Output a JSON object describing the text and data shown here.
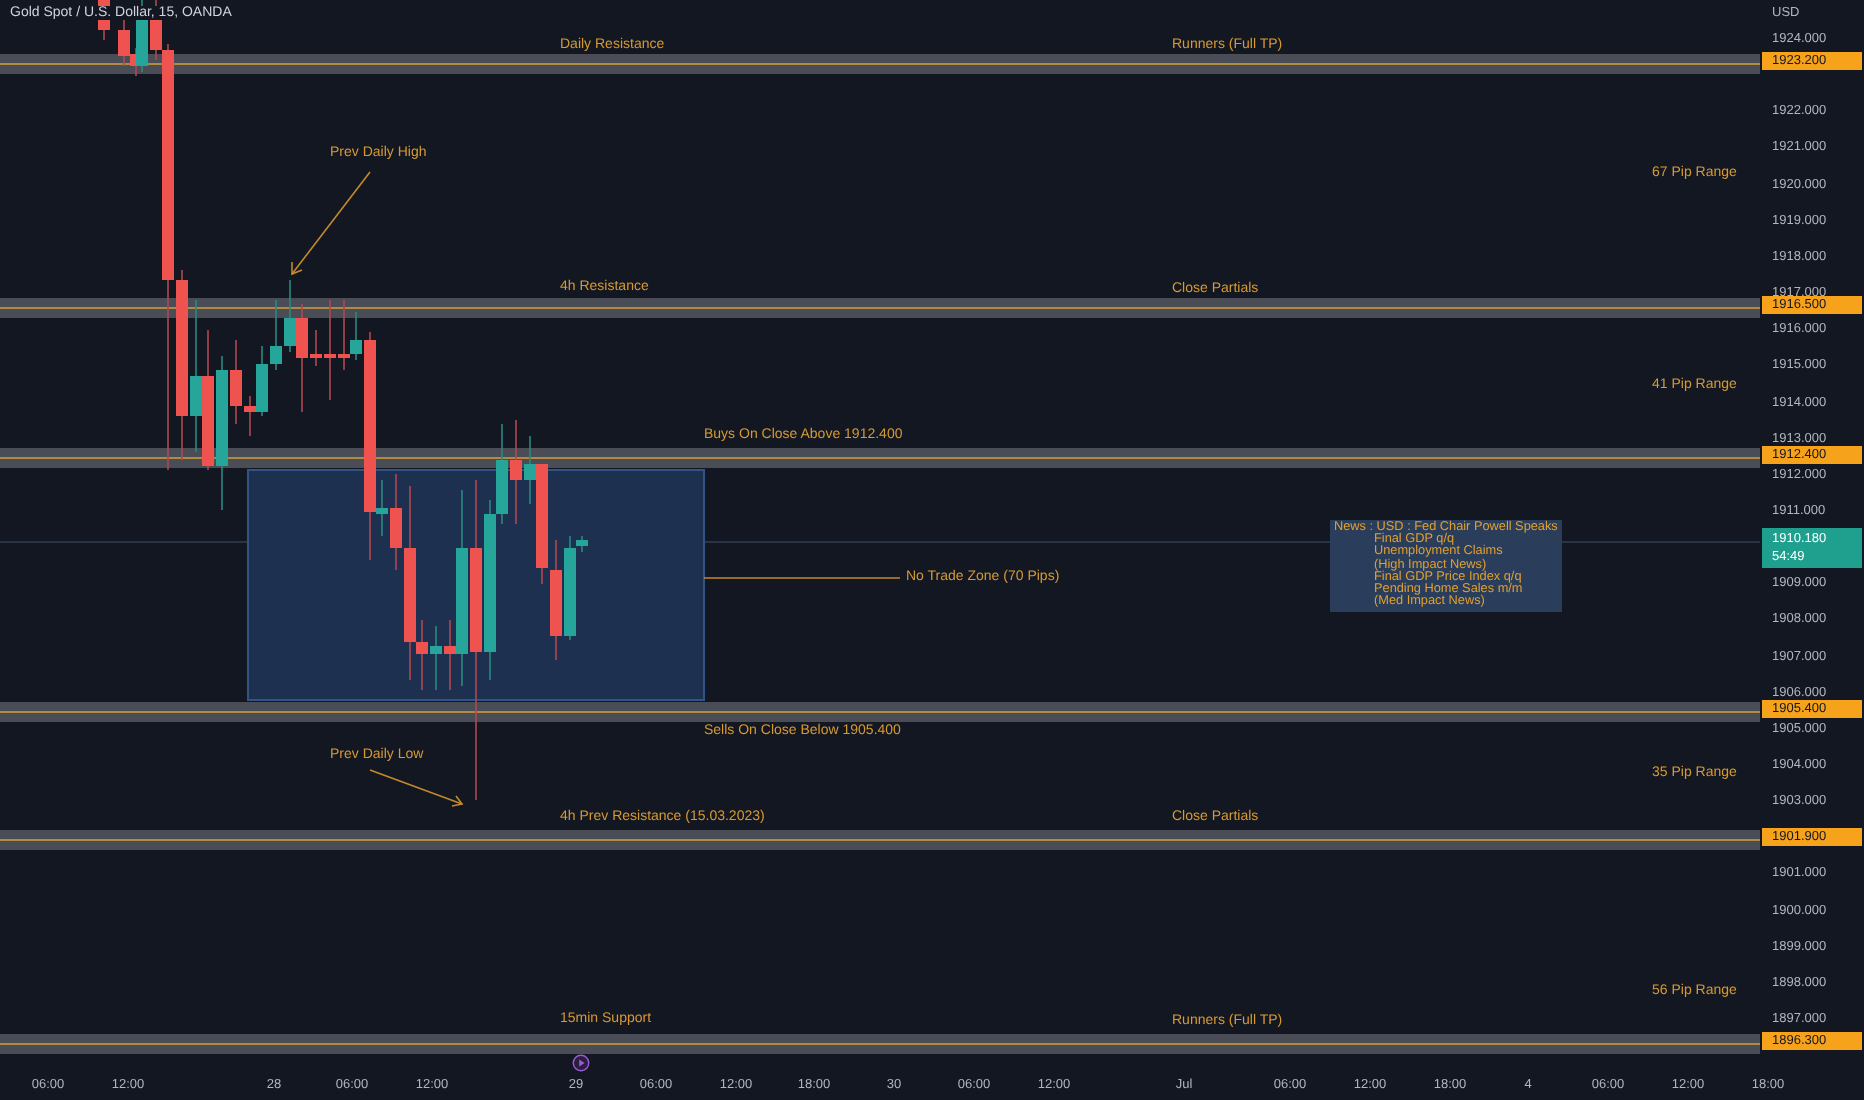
{
  "chart": {
    "title": "Gold Spot / U.S. Dollar, 15, OANDA",
    "annotations": [
      {
        "text": "Daily Resistance"
      },
      {
        "text": "Runners (Full TP)"
      },
      {
        "text": "Prev Daily High"
      },
      {
        "text": "67 Pip Range"
      },
      {
        "text": "4h Resistance"
      },
      {
        "text": "Close Partials"
      },
      {
        "text": "41 Pip Range"
      },
      {
        "text": "Buys On Close Above 1912.400"
      },
      {
        "text": "No Trade Zone (70 Pips)"
      },
      {
        "text": "Sells On Close Below 1905.400"
      },
      {
        "text": "Prev Daily Low"
      },
      {
        "text": "35 Pip Range"
      },
      {
        "text": "4h Prev Resistance (15.03.2023)"
      },
      {
        "text": "Close Partials"
      },
      {
        "text": "56 Pip Range"
      },
      {
        "text": "15min Support"
      },
      {
        "text": "Runners (Full TP)"
      }
    ],
    "news": {
      "lines": [
        "News : USD : Fed Chair Powell Speaks",
        "Final GDP q/q",
        "Unemployment Claims",
        "(High Impact News)",
        "Final GDP Price Index q/q",
        "Pending Home Sales m/m",
        "(Med Impact News)"
      ]
    }
  },
  "price_axis": {
    "unit": "USD",
    "ticks": [
      "1924.000",
      "1922.000",
      "1921.000",
      "1920.000",
      "1919.000",
      "1918.000",
      "1917.000",
      "1916.000",
      "1915.000",
      "1914.000",
      "1913.000",
      "1912.000",
      "1911.000",
      "1909.000",
      "1908.000",
      "1907.000",
      "1906.000",
      "1905.000",
      "1904.000",
      "1903.000",
      "1901.000",
      "1900.000",
      "1899.000",
      "1898.000",
      "1897.000"
    ],
    "levels": [
      "1923.200",
      "1916.500",
      "1912.400",
      "1905.400",
      "1901.900",
      "1896.300"
    ],
    "current_price": "1910.180",
    "countdown": "54:49"
  },
  "time_axis": {
    "labels": [
      "06:00",
      "12:00",
      "28",
      "06:00",
      "12:00",
      "29",
      "06:00",
      "12:00",
      "18:00",
      "30",
      "06:00",
      "12:00",
      "Jul",
      "06:00",
      "12:00",
      "18:00",
      "4",
      "06:00",
      "12:00",
      "18:00"
    ]
  }
}
